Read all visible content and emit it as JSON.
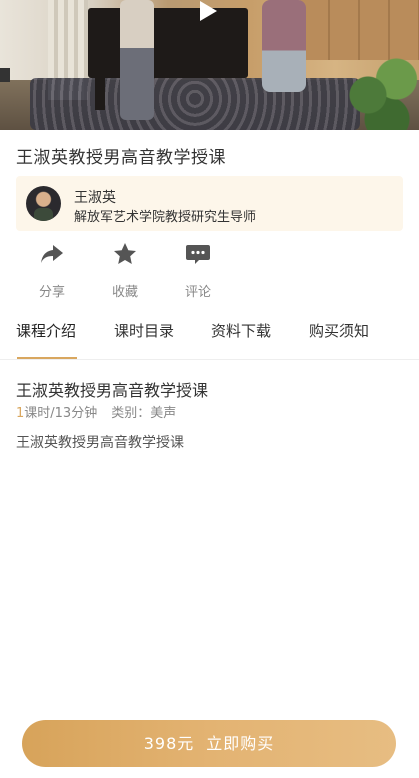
{
  "video": {
    "play_icon": "play-icon"
  },
  "course": {
    "title": "王淑英教授男高音教学授课"
  },
  "teacher": {
    "name": "王淑英",
    "description": "解放军艺术学院教授研究生导师"
  },
  "actions": [
    {
      "label": "分享",
      "icon": "share-icon"
    },
    {
      "label": "收藏",
      "icon": "star-icon"
    },
    {
      "label": "评论",
      "icon": "comment-icon"
    }
  ],
  "tabs": [
    {
      "label": "课程介绍",
      "active": true
    },
    {
      "label": "课时目录",
      "active": false
    },
    {
      "label": "资料下载",
      "active": false
    },
    {
      "label": "购买须知",
      "active": false
    }
  ],
  "intro": {
    "title": "王淑英教授男高音教学授课",
    "lesson_count": "1",
    "lesson_suffix": "课时/13分钟",
    "category": "类别：美声",
    "description": "王淑英教授男高音教学授课"
  },
  "buy": {
    "price": "398元",
    "label": "立即购买"
  },
  "colors": {
    "accent": "#d9a75f",
    "card_bg": "#fdf6ea",
    "muted_text": "#888888"
  }
}
